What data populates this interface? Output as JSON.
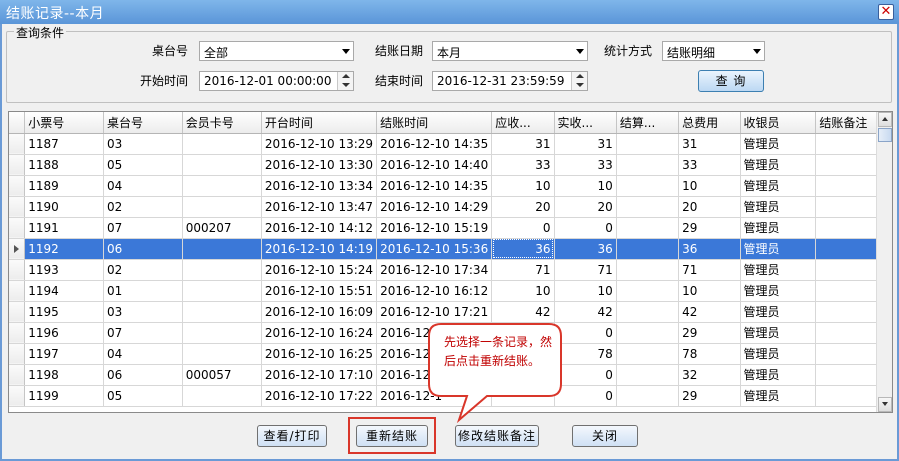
{
  "window": {
    "title": "结账记录--本月",
    "close_glyph": "✕"
  },
  "query": {
    "legend": "查询条件",
    "table_label": "桌台号",
    "table_value": "全部",
    "date_label": "结账日期",
    "date_value": "本月",
    "stat_label": "统计方式",
    "stat_value": "结账明细",
    "start_label": "开始时间",
    "start_value": "2016-12-01 00:00:00",
    "end_label": "结束时间",
    "end_value": "2016-12-31 23:59:59",
    "query_button": "查 询"
  },
  "grid": {
    "columns": [
      "小票号",
      "桌台号",
      "会员卡号",
      "开台时间",
      "结账时间",
      "应收...",
      "实收...",
      "结算...",
      "总费用",
      "收银员",
      "结账备注"
    ],
    "selected_row": 5,
    "rows": [
      [
        "1187",
        "03",
        "",
        "2016-12-10 13:29",
        "2016-12-10 14:35",
        "31",
        "31",
        "",
        "31",
        "管理员",
        ""
      ],
      [
        "1188",
        "05",
        "",
        "2016-12-10 13:30",
        "2016-12-10 14:40",
        "33",
        "33",
        "",
        "33",
        "管理员",
        ""
      ],
      [
        "1189",
        "04",
        "",
        "2016-12-10 13:34",
        "2016-12-10 14:35",
        "10",
        "10",
        "",
        "10",
        "管理员",
        ""
      ],
      [
        "1190",
        "02",
        "",
        "2016-12-10 13:47",
        "2016-12-10 14:29",
        "20",
        "20",
        "",
        "20",
        "管理员",
        ""
      ],
      [
        "1191",
        "07",
        "000207",
        "2016-12-10 14:12",
        "2016-12-10 15:19",
        "0",
        "0",
        "",
        "29",
        "管理员",
        ""
      ],
      [
        "1192",
        "06",
        "",
        "2016-12-10 14:19",
        "2016-12-10 15:36",
        "36",
        "36",
        "",
        "36",
        "管理员",
        ""
      ],
      [
        "1193",
        "02",
        "",
        "2016-12-10 15:24",
        "2016-12-10 17:34",
        "71",
        "71",
        "",
        "71",
        "管理员",
        ""
      ],
      [
        "1194",
        "01",
        "",
        "2016-12-10 15:51",
        "2016-12-10 16:12",
        "10",
        "10",
        "",
        "10",
        "管理员",
        ""
      ],
      [
        "1195",
        "03",
        "",
        "2016-12-10 16:09",
        "2016-12-10 17:21",
        "42",
        "42",
        "",
        "42",
        "管理员",
        ""
      ],
      [
        "1196",
        "07",
        "",
        "2016-12-10 16:24",
        "2016-12-1",
        "",
        "0",
        "",
        "29",
        "管理员",
        ""
      ],
      [
        "1197",
        "04",
        "",
        "2016-12-10 16:25",
        "2016-12-1",
        "",
        "78",
        "",
        "78",
        "管理员",
        ""
      ],
      [
        "1198",
        "06",
        "000057",
        "2016-12-10 17:10",
        "2016-12-1",
        "",
        "0",
        "",
        "32",
        "管理员",
        ""
      ],
      [
        "1199",
        "05",
        "",
        "2016-12-10 17:22",
        "2016-12-1",
        "",
        "0",
        "",
        "29",
        "管理员",
        ""
      ]
    ]
  },
  "tooltip": {
    "text": "先选择一条记录，然后点击重新结账。"
  },
  "buttons": {
    "print": "查看/打印",
    "rebill": "重新结账",
    "edit_note": "修改结账备注",
    "close": "关闭"
  }
}
